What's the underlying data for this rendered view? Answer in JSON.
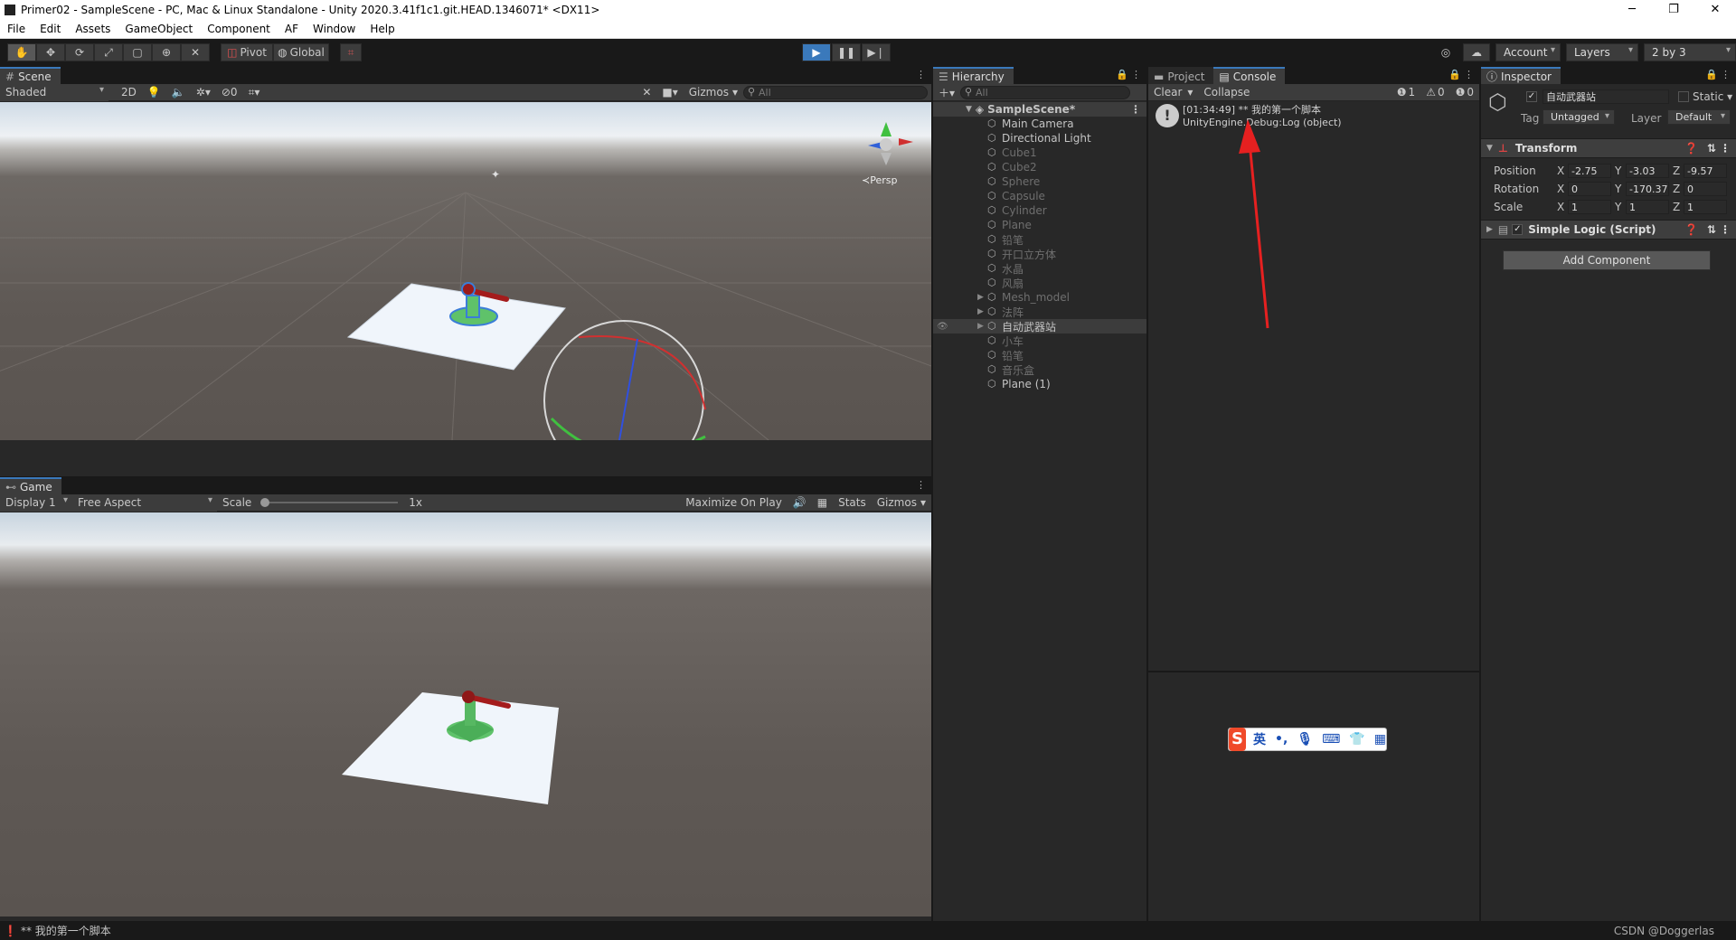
{
  "window": {
    "title": "Primer02 - SampleScene - PC, Mac & Linux Standalone - Unity 2020.3.41f1c1.git.HEAD.1346071* <DX11>",
    "minimize": "─",
    "restore": "❐",
    "close": "✕"
  },
  "menu": [
    "File",
    "Edit",
    "Assets",
    "GameObject",
    "Component",
    "AF",
    "Window",
    "Help"
  ],
  "toolbar": {
    "pivot": "Pivot",
    "global": "Global",
    "account": "Account",
    "layers": "Layers",
    "layout": "2 by 3"
  },
  "scene": {
    "tab": "Scene",
    "shading": "Shaded",
    "mode2d": "2D",
    "hidden_count": "0",
    "gizmos": "Gizmos",
    "search_placeholder": "All",
    "persp": "≺Persp"
  },
  "game": {
    "tab": "Game",
    "display": "Display 1",
    "aspect": "Free Aspect",
    "scale_label": "Scale",
    "scale_value": "1x",
    "maximize": "Maximize On Play",
    "stats": "Stats",
    "gizmos": "Gizmos"
  },
  "hierarchy": {
    "tab": "Hierarchy",
    "search_placeholder": "All",
    "scene_name": "SampleScene*",
    "items": [
      {
        "label": "Main Camera",
        "dim": false,
        "arrow": false
      },
      {
        "label": "Directional Light",
        "dim": false,
        "arrow": false
      },
      {
        "label": "Cube1",
        "dim": true,
        "arrow": false
      },
      {
        "label": "Cube2",
        "dim": true,
        "arrow": false
      },
      {
        "label": "Sphere",
        "dim": true,
        "arrow": false
      },
      {
        "label": "Capsule",
        "dim": true,
        "arrow": false
      },
      {
        "label": "Cylinder",
        "dim": true,
        "arrow": false
      },
      {
        "label": "Plane",
        "dim": true,
        "arrow": false
      },
      {
        "label": "铅笔",
        "dim": true,
        "arrow": false
      },
      {
        "label": "开口立方体",
        "dim": true,
        "arrow": false
      },
      {
        "label": "水晶",
        "dim": true,
        "arrow": false
      },
      {
        "label": "风扇",
        "dim": true,
        "arrow": false
      },
      {
        "label": "Mesh_model",
        "dim": true,
        "arrow": true
      },
      {
        "label": "法阵",
        "dim": true,
        "arrow": true
      },
      {
        "label": "自动武器站",
        "dim": false,
        "arrow": true,
        "selected": true
      },
      {
        "label": "小车",
        "dim": true,
        "arrow": false
      },
      {
        "label": "铅笔",
        "dim": true,
        "arrow": false
      },
      {
        "label": "音乐盒",
        "dim": true,
        "arrow": false
      },
      {
        "label": "Plane (1)",
        "dim": false,
        "arrow": false
      }
    ]
  },
  "console": {
    "tab_project": "Project",
    "tab_console": "Console",
    "clear": "Clear",
    "collapse": "Collapse",
    "count_log": "1",
    "count_warn": "0",
    "count_error": "0",
    "entry_line1": "[01:34:49] ** 我的第一个脚本",
    "entry_line2": "UnityEngine.Debug:Log (object)"
  },
  "inspector": {
    "tab": "Inspector",
    "object_name": "自动武器站",
    "static_label": "Static",
    "tag_label": "Tag",
    "tag_value": "Untagged",
    "layer_label": "Layer",
    "layer_value": "Default",
    "transform": "Transform",
    "position_label": "Position",
    "rotation_label": "Rotation",
    "scale_label": "Scale",
    "position": {
      "x": "-2.75",
      "y": "-3.03",
      "z": "-9.57"
    },
    "rotation": {
      "x": "0",
      "y": "-170.37",
      "z": "0"
    },
    "scale": {
      "x": "1",
      "y": "1",
      "z": "1"
    },
    "script": "Simple Logic (Script)",
    "add_component": "Add Component"
  },
  "ime": {
    "label": "英"
  },
  "status": {
    "message": "** 我的第一个脚本",
    "watermark": "CSDN @Doggerlas"
  }
}
